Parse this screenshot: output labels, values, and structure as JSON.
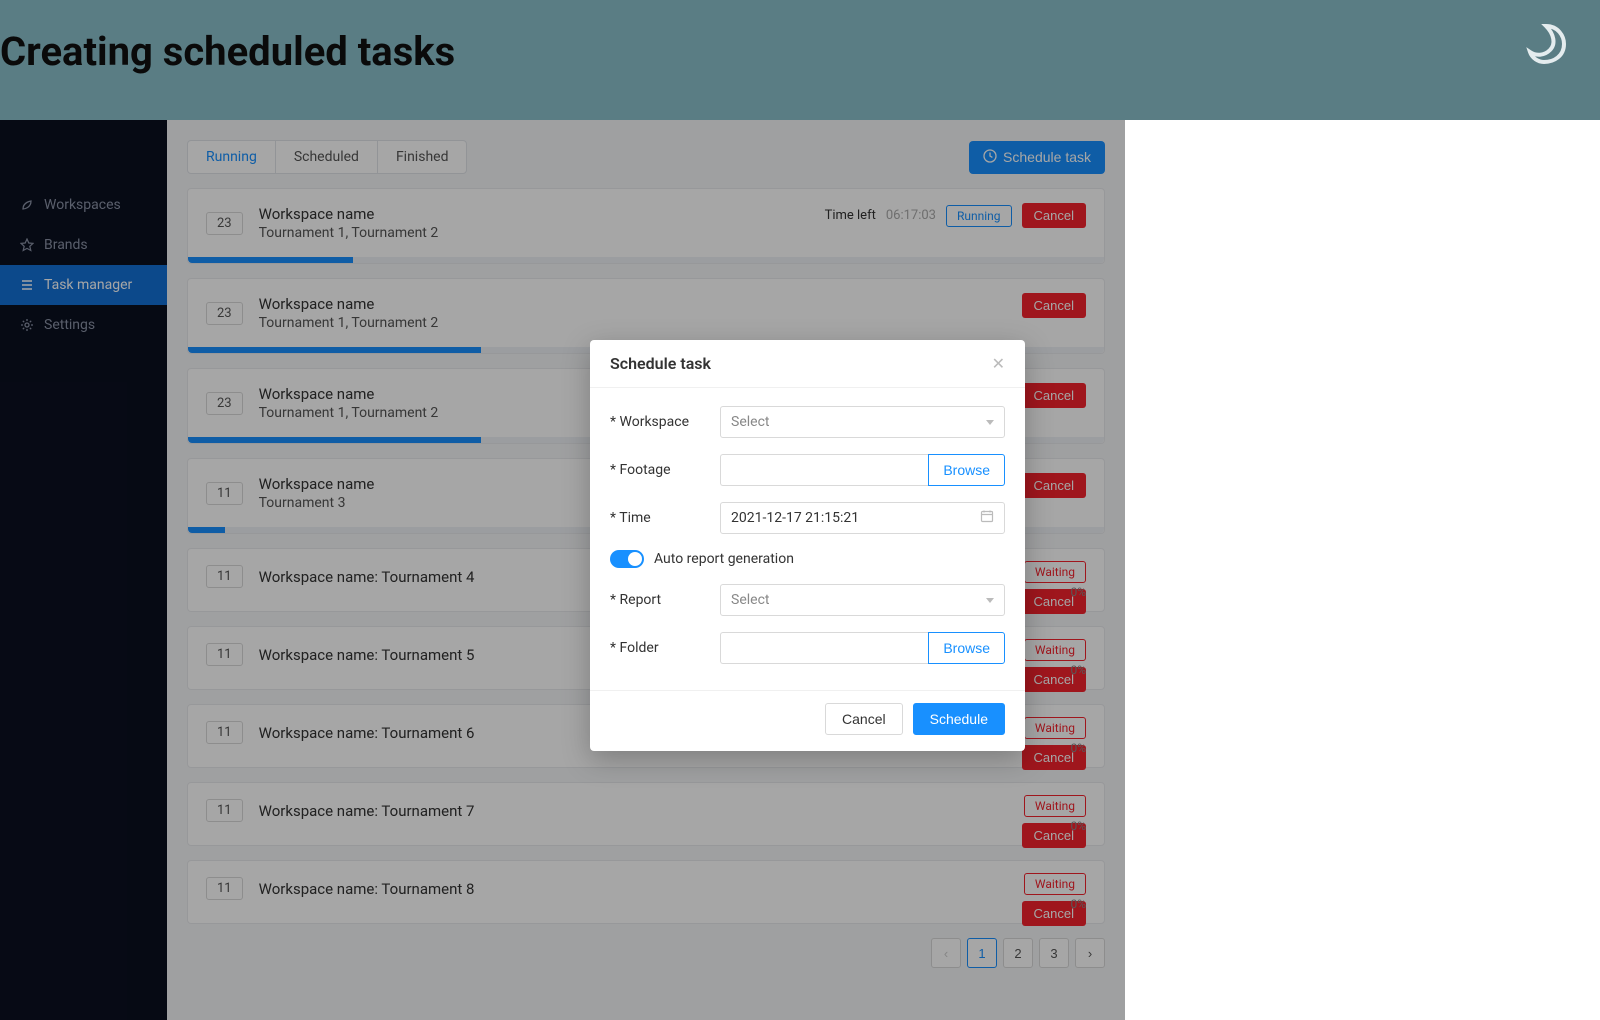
{
  "header": {
    "title": "Creating scheduled tasks"
  },
  "sidebar": {
    "items": [
      {
        "label": "Workspaces",
        "icon": "leaf-icon",
        "active": false
      },
      {
        "label": "Brands",
        "icon": "star-icon",
        "active": false
      },
      {
        "label": "Task manager",
        "icon": "list-icon",
        "active": true
      },
      {
        "label": "Settings",
        "icon": "gear-icon",
        "active": false
      }
    ]
  },
  "tabs": [
    {
      "label": "Running",
      "active": true
    },
    {
      "label": "Scheduled",
      "active": false
    },
    {
      "label": "Finished",
      "active": false
    }
  ],
  "schedule_button": "Schedule task",
  "tasks": {
    "running": [
      {
        "num": "23",
        "title": "Workspace name",
        "sub": "Tournament 1, Tournament 2",
        "time_left_label": "Time left",
        "time_left": "06:17:03",
        "status": "Running",
        "cancel": "Cancel",
        "progress": 18
      },
      {
        "num": "23",
        "title": "Workspace name",
        "sub": "Tournament 1, Tournament 2",
        "cancel": "Cancel",
        "progress": 32
      },
      {
        "num": "23",
        "title": "Workspace name",
        "sub": "Tournament 1, Tournament 2",
        "cancel": "Cancel",
        "progress": 32
      },
      {
        "num": "11",
        "title": "Workspace name",
        "sub": "Tournament 3",
        "cancel": "Cancel",
        "progress": 4
      }
    ],
    "waiting": [
      {
        "num": "11",
        "title": "Workspace name: Tournament 4",
        "status": "Waiting",
        "cancel": "Cancel",
        "pct": "0%"
      },
      {
        "num": "11",
        "title": "Workspace name: Tournament 5",
        "status": "Waiting",
        "cancel": "Cancel",
        "pct": "0%"
      },
      {
        "num": "11",
        "title": "Workspace name: Tournament 6",
        "status": "Waiting",
        "cancel": "Cancel",
        "pct": "0%"
      },
      {
        "num": "11",
        "title": "Workspace name: Tournament 7",
        "status": "Waiting",
        "cancel": "Cancel",
        "pct": "0%"
      },
      {
        "num": "11",
        "title": "Workspace name: Tournament 8",
        "status": "Waiting",
        "cancel": "Cancel",
        "pct": "0%"
      }
    ]
  },
  "pagination": {
    "prev": "‹",
    "pages": [
      "1",
      "2",
      "3"
    ],
    "next": "›",
    "active": "1"
  },
  "modal": {
    "title": "Schedule task",
    "fields": {
      "workspace": {
        "label": "Workspace",
        "placeholder": "Select"
      },
      "footage": {
        "label": "Footage",
        "browse": "Browse"
      },
      "time": {
        "label": "Time",
        "value": "2021-12-17 21:15:21"
      },
      "auto_report": {
        "label": "Auto report generation",
        "on": true
      },
      "report": {
        "label": "Report",
        "placeholder": "Select"
      },
      "folder": {
        "label": "Folder",
        "browse": "Browse"
      }
    },
    "cancel": "Cancel",
    "schedule": "Schedule"
  }
}
